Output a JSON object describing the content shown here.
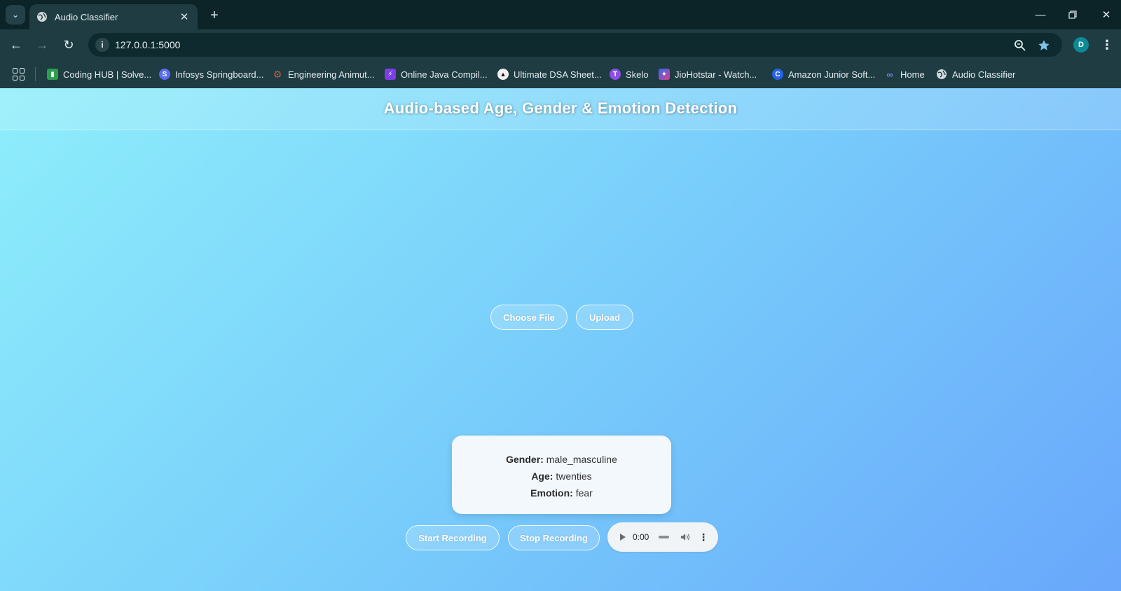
{
  "browser": {
    "tab": {
      "title": "Audio Classifier"
    },
    "address": {
      "url": "127.0.0.1:5000"
    },
    "profile_initial": "D",
    "bookmarks": [
      {
        "label": "Coding HUB | Solve...",
        "icon": "coding-hub-icon",
        "color": "#2e9d4f"
      },
      {
        "label": "Infosys Springboard...",
        "icon": "infosys-icon",
        "color": "#5b6cf0"
      },
      {
        "label": "Engineering Animut...",
        "icon": "engineering-icon",
        "color": "#c0603a"
      },
      {
        "label": "Online Java Compil...",
        "icon": "java-compiler-icon",
        "color": "#7b3fe4"
      },
      {
        "label": "Ultimate DSA Sheet...",
        "icon": "dsa-sheet-icon",
        "color": "#111111"
      },
      {
        "label": "Skelo",
        "icon": "skelo-icon",
        "color": "#8c4fe8"
      },
      {
        "label": "JioHotstar - Watch...",
        "icon": "jiohotstar-icon",
        "color": "#e23a8e"
      },
      {
        "label": "Amazon Junior Soft...",
        "icon": "amazon-junior-icon",
        "color": "#2563eb"
      },
      {
        "label": "Home",
        "icon": "home-link-icon",
        "color": "#6a6fd8"
      },
      {
        "label": "Audio Classifier",
        "icon": "globe-icon",
        "color": "#cfd8da"
      }
    ]
  },
  "page": {
    "title": "Audio-based Age, Gender & Emotion Detection",
    "choose_file_label": "Choose File",
    "upload_label": "Upload",
    "result": {
      "gender_label": "Gender:",
      "gender_value": "male_masculine",
      "age_label": "Age:",
      "age_value": "twenties",
      "emotion_label": "Emotion:",
      "emotion_value": "fear"
    },
    "start_recording_label": "Start Recording",
    "stop_recording_label": "Stop Recording",
    "audio_player": {
      "time": "0:00"
    }
  },
  "colors": {
    "gradient_start": "#8eeefb",
    "gradient_end": "#69a7fb",
    "chrome_dark": "#0c2327",
    "chrome": "#1f3c43"
  }
}
